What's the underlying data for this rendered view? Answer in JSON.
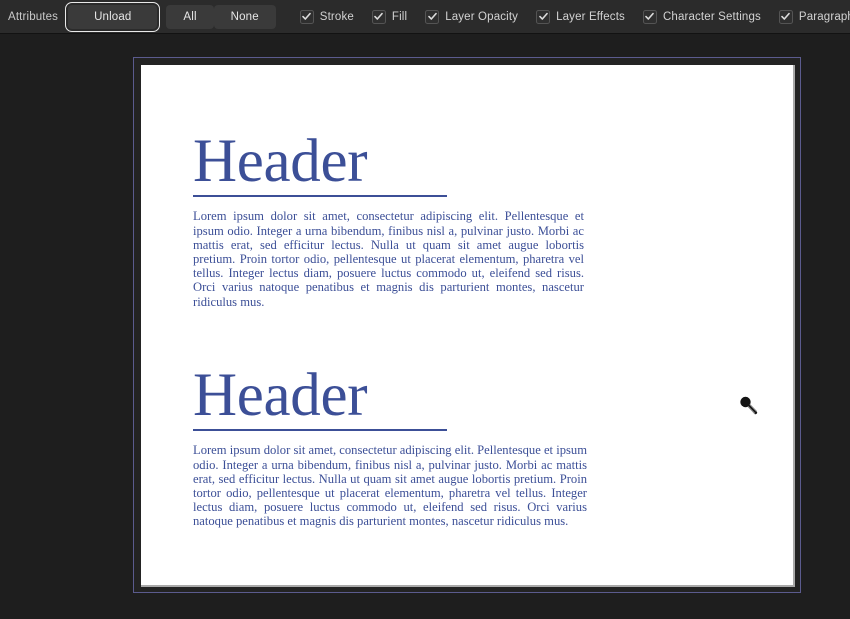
{
  "toolbar": {
    "attributes_label": "Attributes",
    "unload_button": "Unload",
    "all_button": "All",
    "none_button": "None",
    "checkboxes": [
      {
        "label": "Stroke",
        "checked": true,
        "icon": "checkmark-icon"
      },
      {
        "label": "Fill",
        "checked": true,
        "icon": "checkmark-icon"
      },
      {
        "label": "Layer Opacity",
        "checked": true,
        "icon": "checkmark-icon"
      },
      {
        "label": "Layer Effects",
        "checked": true,
        "icon": "checkmark-icon"
      },
      {
        "label": "Character Settings",
        "checked": true,
        "icon": "checkmark-icon"
      },
      {
        "label": "Paragraph Settings",
        "checked": true,
        "icon": "checkmark-icon"
      }
    ]
  },
  "canvas": {
    "cursor_icon": "eyedropper-cursor-icon",
    "selection_color": "#5b5b8e",
    "page_background": "#ffffff",
    "workspace_background": "#1e1e1e"
  },
  "document": {
    "text_color": "#3c4f97",
    "blocks": [
      {
        "header": "Header",
        "body": "Lorem ipsum dolor sit amet, consectetur adipiscing elit. Pellentesque et ipsum odio. Integer a urna bibendum, finibus nisl a, pulvinar justo. Morbi ac mattis erat, sed efficitur lectus. Nulla ut quam sit amet augue lobortis pretium. Proin tortor odio, pellentesque ut placerat elementum, pharetra vel tellus. Integer lectus diam, posuere luctus commodo ut, eleifend sed risus. Orci varius natoque penatibus et magnis dis parturient montes, nascetur ridiculus mus."
      },
      {
        "header": "Header",
        "body": "Lorem ipsum dolor sit amet, consectetur adipiscing elit. Pellentesque et ipsum odio. Integer a urna bibendum, finibus nisl a, pulvinar justo. Morbi ac mattis erat, sed efficitur lectus. Nulla ut quam sit amet augue lobortis pretium. Proin tortor odio, pellentesque ut placerat elementum, pharetra vel tellus. Integer lectus diam, posuere luctus commodo ut, eleifend sed risus. Orci varius natoque penatibus et magnis dis parturient montes, nascetur ridiculus mus."
      }
    ]
  }
}
